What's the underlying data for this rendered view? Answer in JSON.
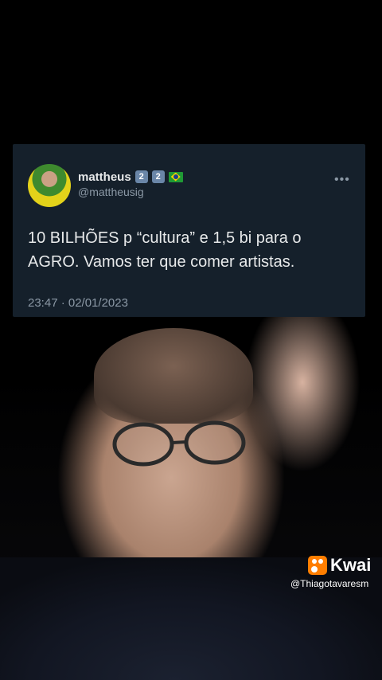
{
  "tweet": {
    "user_name": "mattheus",
    "badges": [
      "2",
      "2"
    ],
    "handle": "@mattheusig",
    "text": "10 BILHÕES p “cultura” e 1,5 bi para o AGRO. Vamos ter que comer artistas.",
    "timestamp": "23:47 · 02/01/2023",
    "more_icon": "more-dots-icon",
    "flag_icon": "brazil-flag-icon"
  },
  "watermark": {
    "brand": "Kwai",
    "username": "@Thiagotavaresm",
    "logo_icon": "kwai-logo-icon",
    "brand_color": "#ff7e00"
  },
  "colors": {
    "card_bg": "#15202b",
    "text_primary": "#e7e9ea",
    "text_secondary": "#8b98a5"
  }
}
